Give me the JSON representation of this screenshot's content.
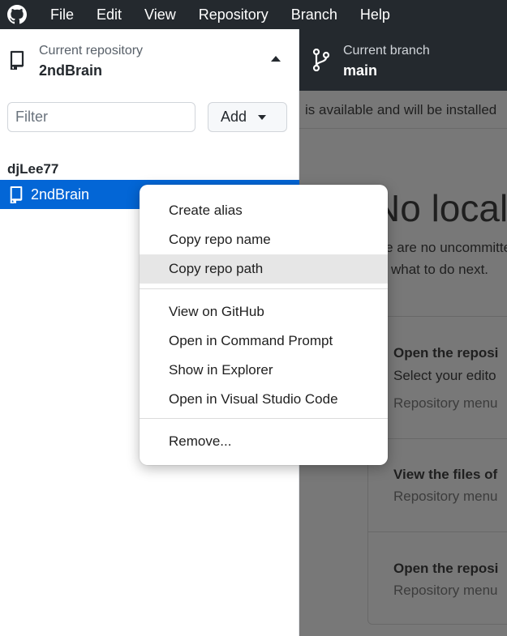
{
  "menubar": {
    "items": [
      "File",
      "Edit",
      "View",
      "Repository",
      "Branch",
      "Help"
    ]
  },
  "toolbar": {
    "repo_caption": "Current repository",
    "repo_name": "2ndBrain",
    "branch_caption": "Current branch",
    "branch_name": "main"
  },
  "sidebar": {
    "filter_placeholder": "Filter",
    "add_label": "Add",
    "group": "djLee77",
    "repos": [
      "2ndBrain"
    ]
  },
  "main": {
    "banner": "is available and will be installed",
    "heading": "No local",
    "line1": "ere are no uncommitted",
    "line2": "what to do next.",
    "suggestions": [
      {
        "title": "Open the reposi",
        "desc": "Select your edito",
        "hint": "Repository menu"
      },
      {
        "title": "View the files of",
        "hint": "Repository menu"
      },
      {
        "title": "Open the reposi",
        "hint": "Repository menu"
      }
    ]
  },
  "context_menu": {
    "group1": [
      "Create alias",
      "Copy repo name",
      "Copy repo path"
    ],
    "group2": [
      "View on GitHub",
      "Open in Command Prompt",
      "Show in Explorer",
      "Open in Visual Studio Code"
    ],
    "group3": [
      "Remove..."
    ]
  },
  "colors": {
    "menubar_bg": "#24292e",
    "selected_bg": "#0366d6",
    "overlay_bg": "#787878"
  }
}
